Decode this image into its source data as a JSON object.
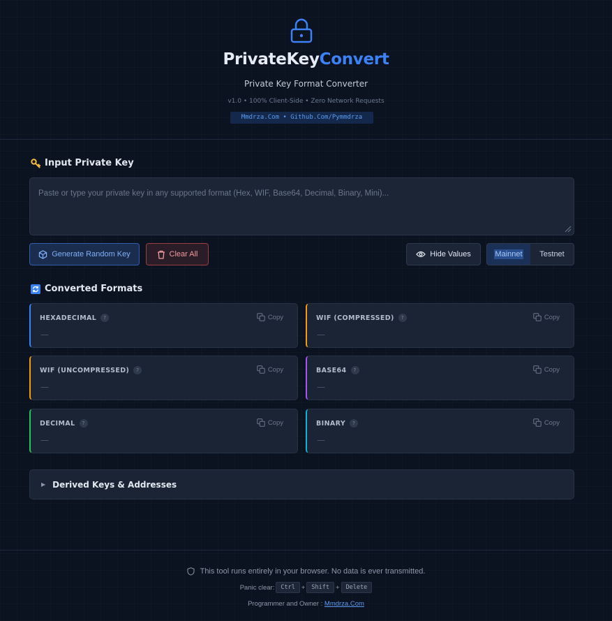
{
  "header": {
    "title_main": "PrivateKey",
    "title_accent": "Convert",
    "subtitle": "Private Key Format Converter",
    "meta": "v1.0 • 100% Client-Side • Zero Network Requests",
    "links": "Mmdrza.Com • Github.Com/Pymmdrza",
    "icon": "lock-icon"
  },
  "input_section": {
    "title": "Input Private Key",
    "icon": "key-icon",
    "placeholder": "Paste or type your private key in any supported format (Hex, WIF, Base64, Decimal, Binary, Mini)..."
  },
  "actions": {
    "generate_label": "Generate Random Key",
    "clear_label": "Clear All",
    "hide_label": "Hide Values",
    "network": {
      "options": [
        "Mainnet",
        "Testnet"
      ],
      "selected": "Mainnet"
    }
  },
  "formats_section": {
    "title": "Converted Formats",
    "icon": "refresh-icon"
  },
  "formats": [
    {
      "label": "HEXADECIMAL",
      "value": "—",
      "copy": "Copy",
      "color": "#3b82f6"
    },
    {
      "label": "WIF (COMPRESSED)",
      "value": "—",
      "copy": "Copy",
      "color": "#f59e0b"
    },
    {
      "label": "WIF (UNCOMPRESSED)",
      "value": "—",
      "copy": "Copy",
      "color": "#f59e0b"
    },
    {
      "label": "BASE64",
      "value": "—",
      "copy": "Copy",
      "color": "#a855f7"
    },
    {
      "label": "DECIMAL",
      "value": "—",
      "copy": "Copy",
      "color": "#22c55e"
    },
    {
      "label": "BINARY",
      "value": "—",
      "copy": "Copy",
      "color": "#06b6d4"
    }
  ],
  "derived": {
    "label": "Derived Keys & Addresses"
  },
  "footer": {
    "notice": "This tool runs entirely in your browser. No data is ever transmitted.",
    "panic_label": "Panic clear:",
    "keys": [
      "Ctrl",
      "Shift",
      "Delete"
    ],
    "plus": "+",
    "owner_label": "Programmer and Owner :",
    "owner_link": "Mmdrza.Com"
  }
}
